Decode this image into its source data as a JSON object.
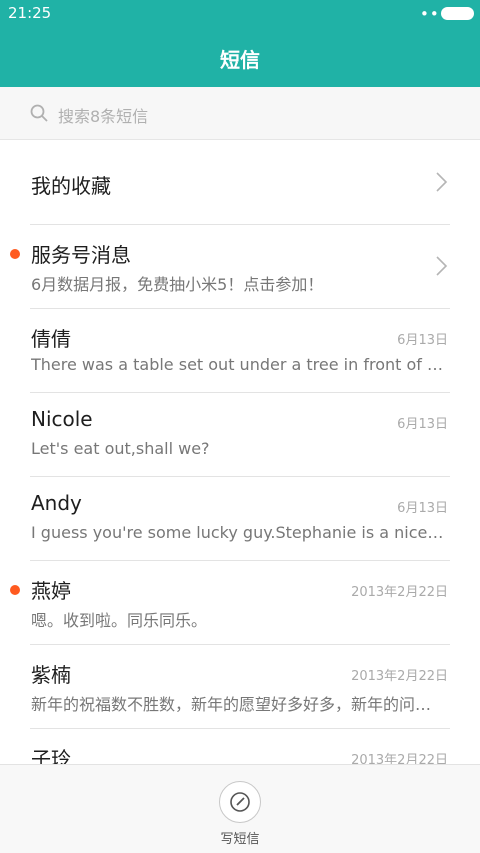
{
  "status_bar": {
    "time": "21:25",
    "dots": "•••"
  },
  "header": {
    "title": "短信"
  },
  "search": {
    "placeholder": "搜索8条短信"
  },
  "favorites": {
    "label": "我的收藏"
  },
  "conversations": [
    {
      "name": "服务号消息",
      "preview": "6月数据月报，免费抽小米5！点击参加！",
      "date": "",
      "unread": true
    },
    {
      "name": "倩倩",
      "preview": "There was a table set out under a tree in front of the house, and the March Hare and the Hatter were having tea at it",
      "date": "6月13日",
      "unread": false
    },
    {
      "name": "Nicole",
      "preview": "Let's eat out,shall we?",
      "date": "6月13日",
      "unread": false
    },
    {
      "name": "Andy",
      "preview": "I guess you're some lucky guy.Stephanie is a nice girl.",
      "date": "6月13日",
      "unread": false
    },
    {
      "name": "燕婷",
      "preview": "嗯。收到啦。同乐同乐。",
      "date": "2013年2月22日",
      "unread": true
    },
    {
      "name": "紫楠",
      "preview": "新年的祝福数不胜数，新年的愿望好多好多，新年的问候送给你",
      "date": "2013年2月22日",
      "unread": false
    },
    {
      "name": "子玲",
      "preview": "",
      "date": "2013年2月22日",
      "unread": false
    }
  ],
  "bottom_bar": {
    "compose_label": "写短信"
  },
  "colors": {
    "accent": "#20b2a6",
    "unread": "#ff5a1f"
  }
}
